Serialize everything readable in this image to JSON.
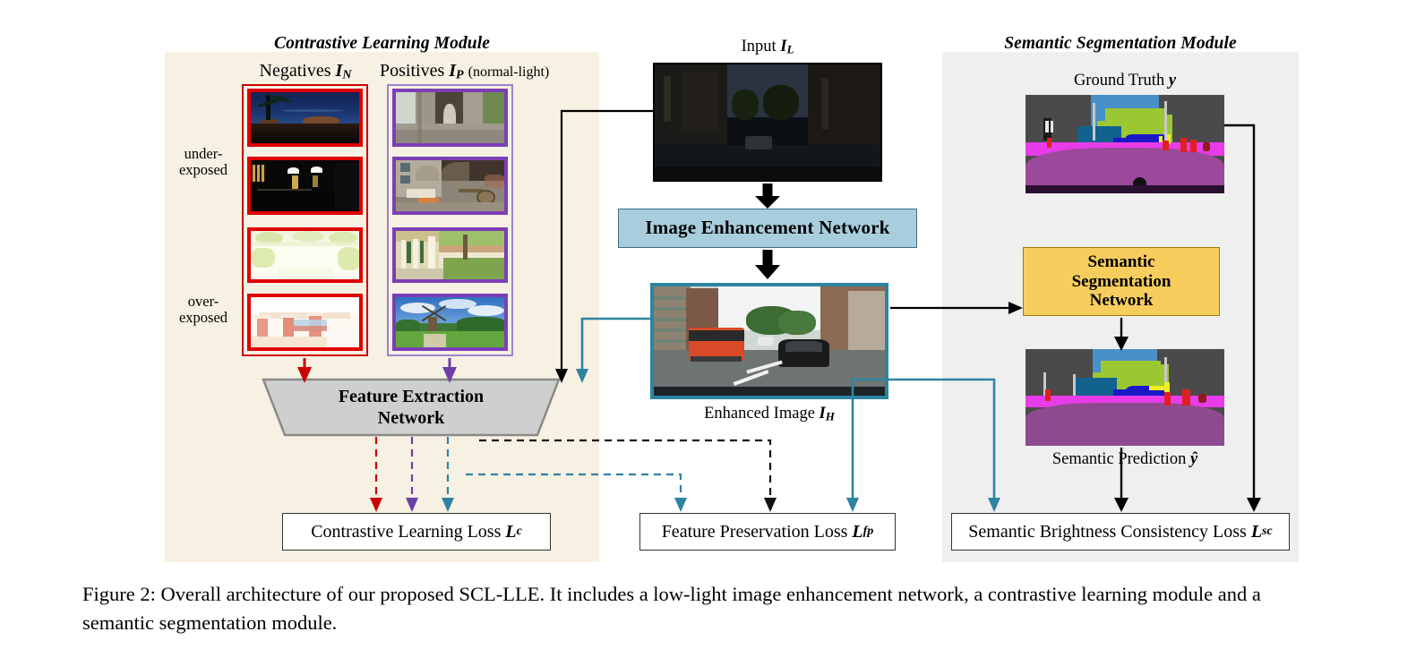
{
  "figure": {
    "caption": "Figure 2: Overall architecture of our proposed SCL-LLE. It includes a low-light image enhancement network, a contrastive learning module and a semantic segmentation module."
  },
  "modules": {
    "contrastive": {
      "title": "Contrastive Learning Module",
      "negatives_label": "Negatives",
      "negatives_symbol": "I",
      "negatives_subscript": "N",
      "positives_label": "Positives",
      "positives_symbol": "I",
      "positives_subscript": "P",
      "positives_note": "(normal-light)",
      "row_label_under": "under-\nexposed",
      "row_label_over": "over-\nexposed",
      "negatives": [
        {
          "name": "joshua-tree-night",
          "exposure": "under-exposed"
        },
        {
          "name": "dark-stairwell-interior",
          "exposure": "under-exposed"
        },
        {
          "name": "overexposed-garden-lawn",
          "exposure": "over-exposed"
        },
        {
          "name": "overexposed-pink-columns-building",
          "exposure": "over-exposed"
        }
      ],
      "positives": [
        {
          "name": "statue-in-stone-archway"
        },
        {
          "name": "courtyard-with-cart"
        },
        {
          "name": "colonnade-walkway"
        },
        {
          "name": "windmill-in-green-field"
        }
      ]
    },
    "semantic": {
      "title": "Semantic Segmentation Module",
      "ground_truth_label": "Ground Truth",
      "ground_truth_symbol": "y",
      "prediction_label": "Semantic Prediction",
      "prediction_symbol": "ŷ",
      "network_label": "Semantic\nSegmentation\nNetwork"
    }
  },
  "pipeline": {
    "input_label": "Input",
    "input_symbol": "I",
    "input_subscript": "L",
    "enhancement_network_label": "Image Enhancement Network",
    "enhanced_label": "Enhanced Image",
    "enhanced_symbol": "I",
    "enhanced_subscript": "H",
    "feature_extraction_label": "Feature Extraction\nNetwork"
  },
  "losses": [
    {
      "name": "contrastive-learning-loss",
      "text": "Contrastive Learning Loss",
      "symbol": "L",
      "subscript": "c"
    },
    {
      "name": "feature-preservation-loss",
      "text": "Feature Preservation Loss",
      "symbol": "L",
      "subscript": "fp"
    },
    {
      "name": "semantic-brightness-consistency-loss",
      "text": "Semantic Brightness Consistency Loss",
      "symbol": "L",
      "subscript": "sc"
    }
  ],
  "colors": {
    "negative_border": "#e00000",
    "positive_border": "#7b3fb5",
    "enhanced_border": "#2d84a0",
    "enhancement_box": "#a8cede",
    "segmentation_box": "#f7cd5e",
    "feature_box": "#cfcfcf",
    "contrastive_panel": "#f7f1e3",
    "semantic_panel": "#efefef",
    "teal_arrow": "#2d84a0",
    "red_arrow": "#cc0000",
    "purple_arrow": "#6f3fa8",
    "black_arrow": "#000000"
  }
}
